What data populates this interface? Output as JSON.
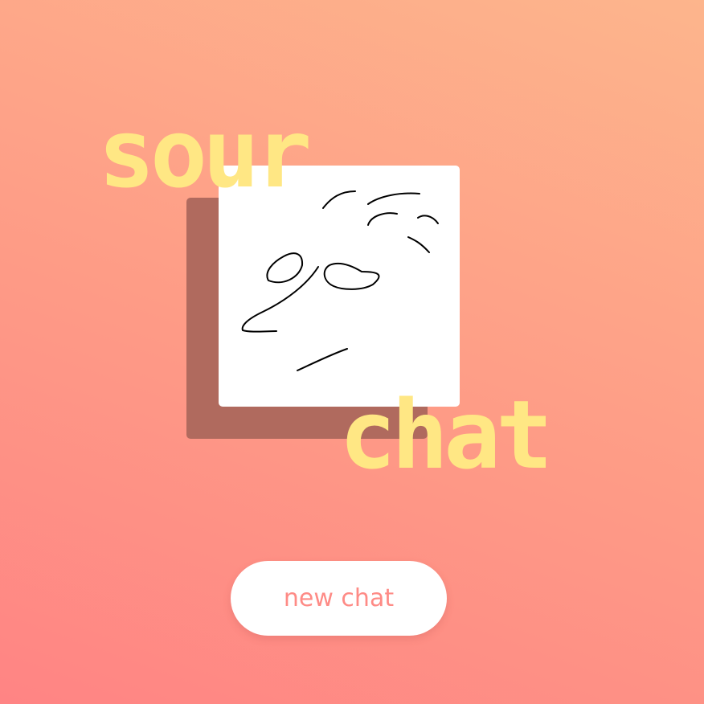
{
  "app": {
    "title_word_1": "sour",
    "title_word_2": "chat"
  },
  "canvas": {
    "background_color": "#ffffff",
    "shadow_color": "#b06a5e",
    "stroke_color": "#000000"
  },
  "actions": {
    "new_chat_label": "new chat"
  },
  "colors": {
    "title": "#ffe784",
    "button_text": "#fe8b86",
    "gradient_top": "#fdb58c",
    "gradient_bottom": "#ff8484"
  }
}
